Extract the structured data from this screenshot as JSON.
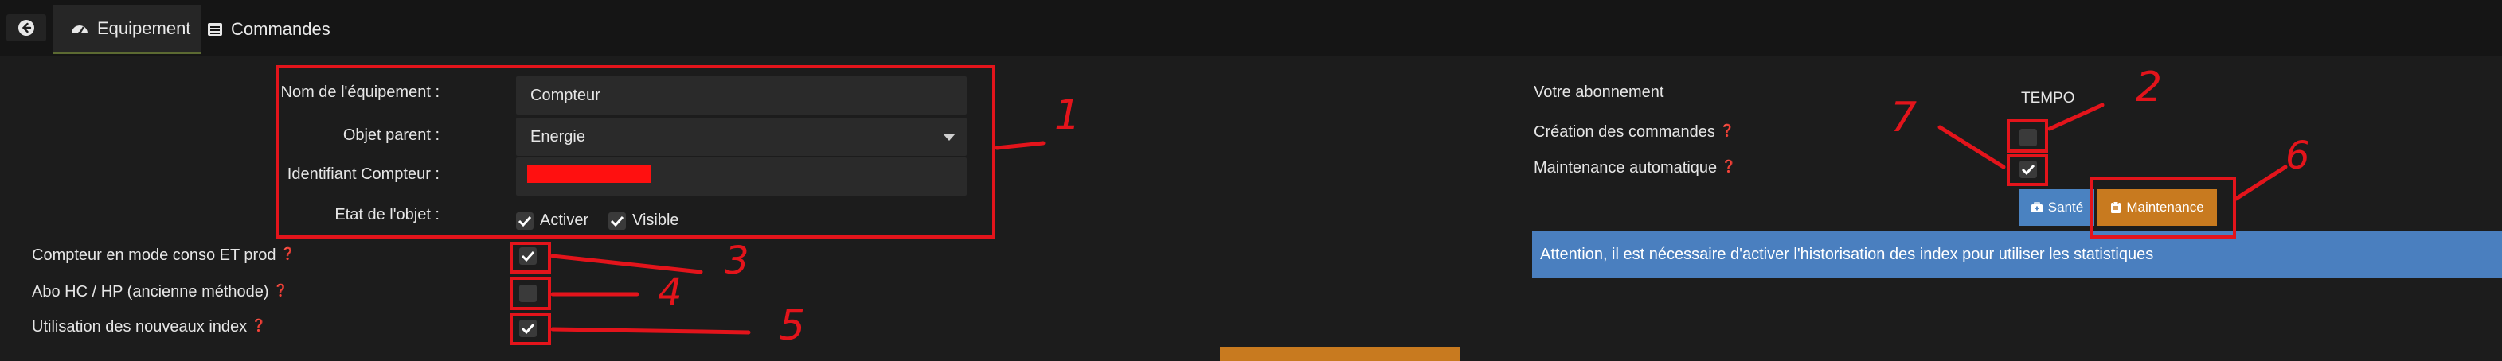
{
  "tabs": {
    "equipement": "Equipement",
    "commandes": "Commandes"
  },
  "form": {
    "nom_label": "Nom de l'équipement :",
    "nom_value": "Compteur",
    "objet_label": "Objet parent :",
    "objet_value": "Energie",
    "identifiant_label": "Identifiant Compteur :",
    "identifiant_value": "",
    "etat_label": "Etat de l'objet :",
    "activer_label": "Activer",
    "visible_label": "Visible"
  },
  "options": {
    "conso_prod_label": "Compteur en mode conso ET prod",
    "abo_label": "Abo HC / HP (ancienne méthode)",
    "nouveaux_index_label": "Utilisation des nouveaux index"
  },
  "right": {
    "abonnement_label": "Votre abonnement",
    "abonnement_value": "TEMPO",
    "creation_label": "Création des commandes",
    "maintenance_auto_label": "Maintenance automatique",
    "sante_button": "Santé",
    "maintenance_button": "Maintenance",
    "alert_text": "Attention, il est nécessaire d'activer l'historisation des index pour utiliser les statistiques"
  },
  "checkboxes": {
    "activer": true,
    "visible": true,
    "conso_prod": true,
    "abo": false,
    "nouveaux_index": true,
    "creation": false,
    "maintenance_auto": true
  },
  "annotations": [
    "1",
    "2",
    "3",
    "4",
    "5",
    "6",
    "7"
  ],
  "colors": {
    "background": "#1c1c1c",
    "annotation_red": "#e3141b",
    "button_blue": "#4a82c1",
    "button_orange": "#c87a1f",
    "alert_blue": "#4a7fbf",
    "help_blue": "#4d86c8"
  }
}
